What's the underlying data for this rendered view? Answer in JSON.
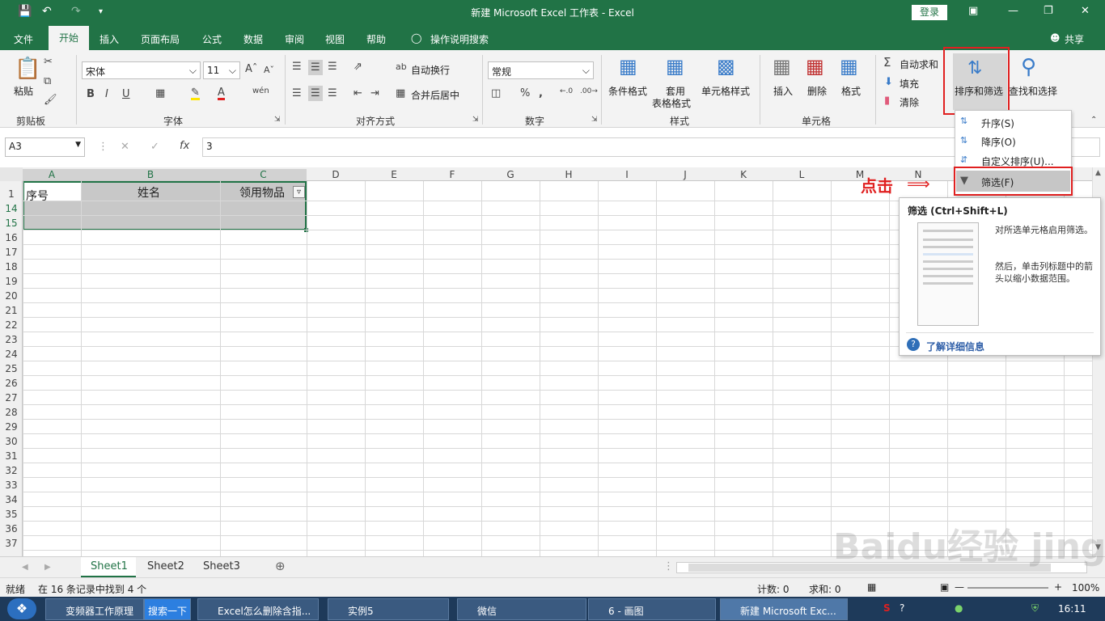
{
  "window": {
    "title": "新建 Microsoft Excel 工作表  -  Excel",
    "login": "登录"
  },
  "menu": {
    "tabs": [
      "文件",
      "开始",
      "插入",
      "页面布局",
      "公式",
      "数据",
      "审阅",
      "视图",
      "帮助"
    ],
    "tell": "操作说明搜索",
    "share": "共享"
  },
  "ribbon": {
    "paste": "粘贴",
    "clipboard": "剪贴板",
    "font_name": "宋体",
    "font_size": "11",
    "font_group": "字体",
    "bold": "B",
    "italic": "I",
    "underline": "U",
    "wrap": "自动换行",
    "merge": "合并后居中",
    "align_group": "对齐方式",
    "num_format": "常规",
    "num_group": "数字",
    "cond_format": "条件格式",
    "table_format_1": "套用",
    "table_format_2": "表格格式",
    "cell_style": "单元格样式",
    "styles_group": "样式",
    "insert": "插入",
    "delete": "删除",
    "format": "格式",
    "cells_group": "单元格",
    "autosum": "自动求和",
    "fill": "填充",
    "clear": "清除",
    "sort_filter": "排序和筛选",
    "find_select": "查找和选择"
  },
  "formula": {
    "namebox": "A3",
    "value": "3"
  },
  "columns": [
    "A",
    "B",
    "C",
    "D",
    "E",
    "F",
    "G",
    "H",
    "I",
    "J",
    "K",
    "L",
    "M",
    "N"
  ],
  "rows": [
    "1",
    "14",
    "15",
    "16",
    "17",
    "18",
    "19",
    "20",
    "21",
    "22",
    "23",
    "24",
    "25",
    "26",
    "27",
    "28",
    "29",
    "30",
    "31",
    "32",
    "33",
    "34",
    "35",
    "36",
    "37"
  ],
  "cells": {
    "a1": "序号",
    "b1": "姓名",
    "c1": "领用物品"
  },
  "dropdown": {
    "items": [
      {
        "label": "升序(S)"
      },
      {
        "label": "降序(O)"
      },
      {
        "label": "自定义排序(U)..."
      },
      {
        "label": "筛选(F)"
      }
    ]
  },
  "annotation": "点击",
  "tooltip": {
    "title": "筛选 (Ctrl+Shift+L)",
    "text1": "对所选单元格启用筛选。",
    "text2": "然后，单击列标题中的箭头以缩小数据范围。",
    "link": "了解详细信息"
  },
  "sheets": [
    "Sheet1",
    "Sheet2",
    "Sheet3"
  ],
  "status": {
    "ready": "就绪",
    "found": "在 16 条记录中找到 4 个",
    "count": "计数: 0",
    "sum": "求和: 0",
    "zoom": "100%"
  },
  "taskbar": {
    "items": [
      "变频器工作原理",
      "搜索一下",
      "Excel怎么删除含指...",
      "实例5",
      "微信",
      "6 - 画图",
      "新建 Microsoft Exc..."
    ],
    "time": "16:11"
  },
  "watermark": "Baidu经验 jingyan.baidu.com",
  "colors": {
    "excel_green": "#217346",
    "highlight_red": "#e02020"
  }
}
